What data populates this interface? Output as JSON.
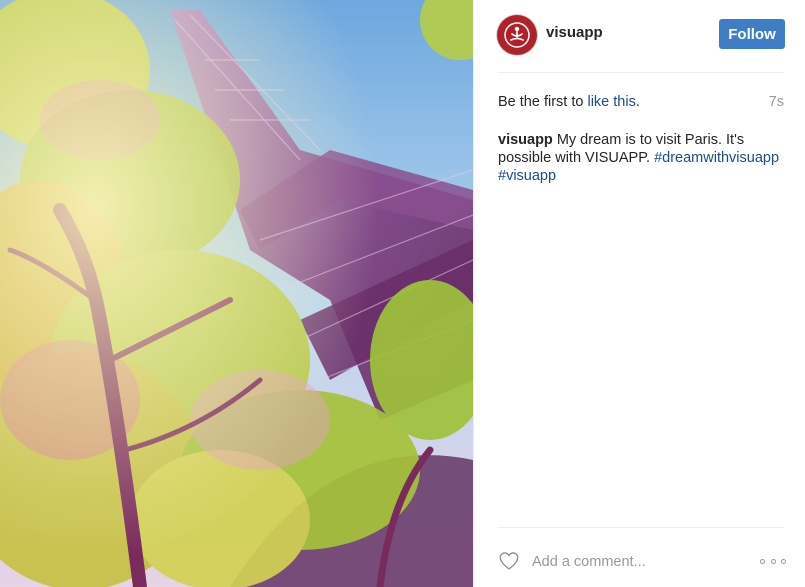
{
  "post": {
    "username": "visuapp",
    "follow_label": "Follow",
    "likes_prefix": "Be the first to",
    "likes_link": "like this",
    "likes_suffix": ".",
    "timestamp": "7s",
    "caption_user": "visuapp",
    "caption_text": "My dream is to visit Paris. It's possible with VISUAPP.",
    "hashtags": [
      "#dreamwithvisuapp",
      "#visuapp"
    ],
    "comment_placeholder": "Add a comment...",
    "avatar_icon": "meditation-figure-icon",
    "photo_subject": "eiffel-tower-photo"
  },
  "colors": {
    "follow_button": "#3f7ec7",
    "link": "#1d4a8c",
    "avatar": "#b0222a",
    "muted": "#999999"
  }
}
